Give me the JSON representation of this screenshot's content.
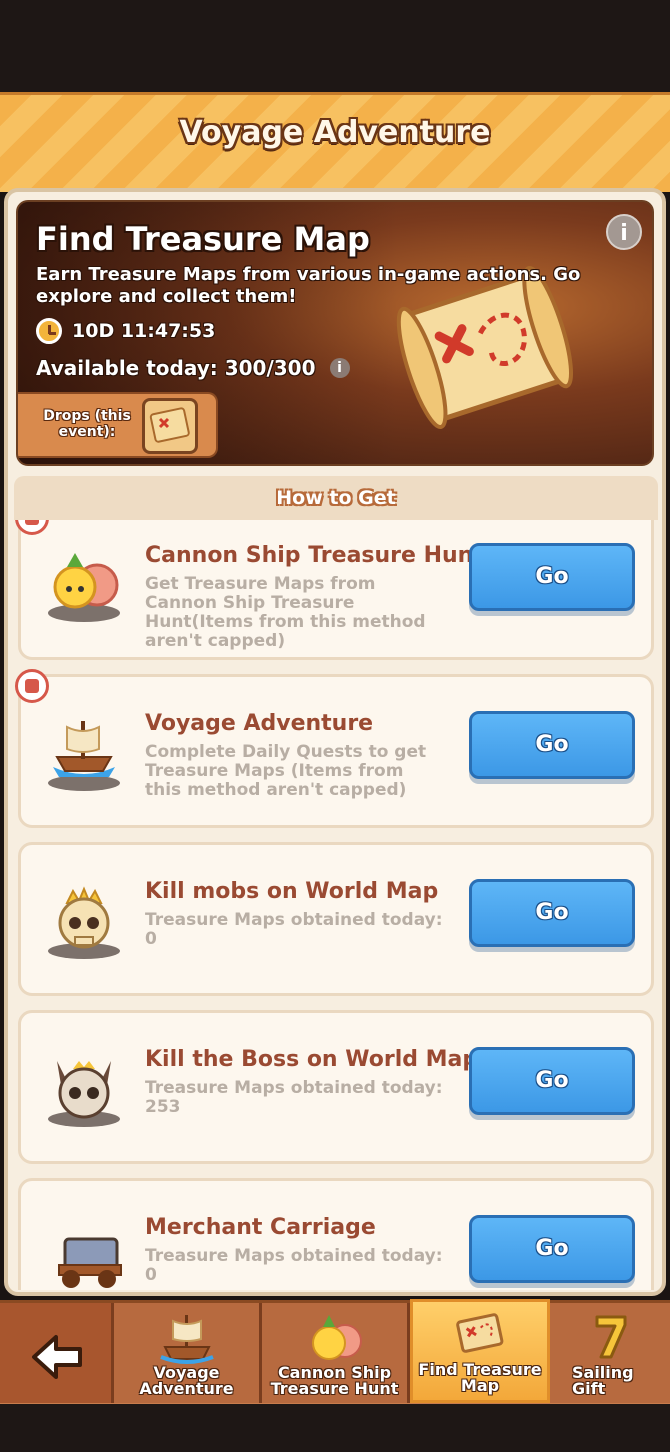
{
  "header": {
    "title": "Voyage Adventure"
  },
  "banner": {
    "title": "Find Treasure Map",
    "description": "Earn Treasure Maps from various in-game actions. Go explore and collect them!",
    "timer": "10D 11:47:53",
    "available": "Available today: 300/300",
    "info_icon": "i",
    "drops_label": "Drops (this event):"
  },
  "section": {
    "title": "How to Get"
  },
  "methods": [
    {
      "title": "Cannon Ship Treasure Hunt",
      "desc": "Get Treasure Maps from Cannon Ship Treasure Hunt(Items from this method aren't capped)",
      "button": "Go",
      "icon": "fruit-octopus-icon",
      "recommended": true
    },
    {
      "title": "Voyage Adventure",
      "desc": "Complete Daily Quests to get Treasure Maps (Items from this method aren't capped)",
      "button": "Go",
      "icon": "ship-icon",
      "recommended": true
    },
    {
      "title": "Kill mobs on World Map",
      "desc": "Treasure Maps obtained today: 0",
      "button": "Go",
      "icon": "crowned-skull-icon",
      "recommended": false
    },
    {
      "title": "Kill the Boss on World Map",
      "desc": "Treasure Maps obtained today: 253",
      "button": "Go",
      "icon": "horned-skull-icon",
      "recommended": false
    },
    {
      "title": "Merchant Carriage",
      "desc": "Treasure Maps obtained today: 0",
      "button": "Go",
      "icon": "carriage-icon",
      "recommended": false
    }
  ],
  "nav": {
    "back": "back-arrow-icon",
    "tabs": [
      {
        "label": "Voyage Adventure",
        "icon": "ship-icon"
      },
      {
        "label": "Cannon Ship Treasure Hunt",
        "icon": "fruit-octopus-icon"
      },
      {
        "label": "Find Treasure Map",
        "icon": "treasure-map-icon"
      },
      {
        "label": "Sailing Gift",
        "icon": "number-seven-icon"
      }
    ]
  }
}
